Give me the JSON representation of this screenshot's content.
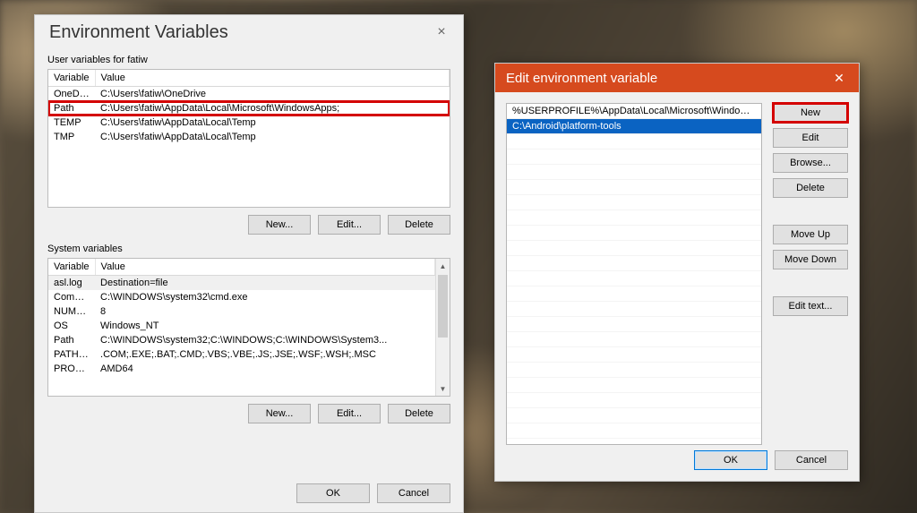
{
  "env_dialog": {
    "title": "Environment Variables",
    "user_group_label": "User variables for fatiw",
    "system_group_label": "System variables",
    "col_variable": "Variable",
    "col_value": "Value",
    "user_vars": [
      {
        "name": "OneDrive",
        "value": "C:\\Users\\fatiw\\OneDrive"
      },
      {
        "name": "Path",
        "value": "C:\\Users\\fatiw\\AppData\\Local\\Microsoft\\WindowsApps;"
      },
      {
        "name": "TEMP",
        "value": "C:\\Users\\fatiw\\AppData\\Local\\Temp"
      },
      {
        "name": "TMP",
        "value": "C:\\Users\\fatiw\\AppData\\Local\\Temp"
      }
    ],
    "system_vars": [
      {
        "name": "asl.log",
        "value": "Destination=file"
      },
      {
        "name": "ComSpec",
        "value": "C:\\WINDOWS\\system32\\cmd.exe"
      },
      {
        "name": "NUMBER_OF_PROCESSORS",
        "value": "8"
      },
      {
        "name": "OS",
        "value": "Windows_NT"
      },
      {
        "name": "Path",
        "value": "C:\\WINDOWS\\system32;C:\\WINDOWS;C:\\WINDOWS\\System3..."
      },
      {
        "name": "PATHEXT",
        "value": ".COM;.EXE;.BAT;.CMD;.VBS;.VBE;.JS;.JSE;.WSF;.WSH;.MSC"
      },
      {
        "name": "PROCESSOR_ARCHITECTU...",
        "value": "AMD64"
      }
    ],
    "btn_new": "New...",
    "btn_edit": "Edit...",
    "btn_delete": "Delete",
    "btn_ok": "OK",
    "btn_cancel": "Cancel"
  },
  "edit_dialog": {
    "title": "Edit environment variable",
    "paths": [
      "%USERPROFILE%\\AppData\\Local\\Microsoft\\WindowsApps",
      "C:\\Android\\platform-tools"
    ],
    "selected_index": 1,
    "btn_new": "New",
    "btn_edit": "Edit",
    "btn_browse": "Browse...",
    "btn_delete": "Delete",
    "btn_moveup": "Move Up",
    "btn_movedown": "Move Down",
    "btn_edittext": "Edit text...",
    "btn_ok": "OK",
    "btn_cancel": "Cancel"
  },
  "highlight": {
    "user_path_row": true,
    "new_button": true
  }
}
